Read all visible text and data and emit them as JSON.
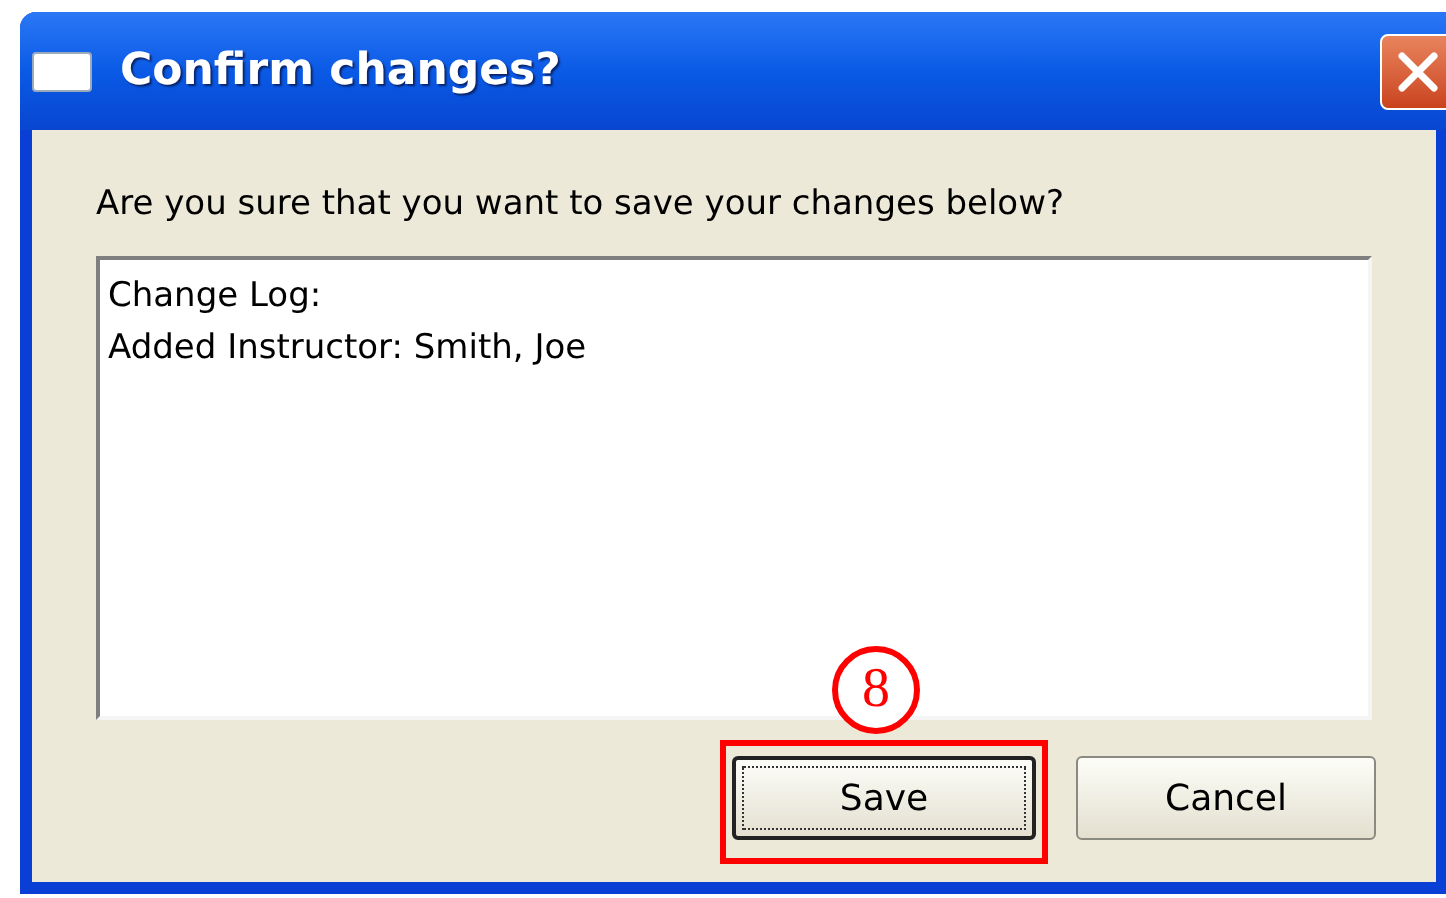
{
  "window": {
    "title": "Confirm changes?"
  },
  "prompt": "Are you sure that you want to save your changes below?",
  "change_log": {
    "lines": [
      "Change Log:",
      "Added Instructor: Smith, Joe"
    ]
  },
  "buttons": [
    {
      "label": "Save",
      "default": true,
      "highlighted": true
    },
    {
      "label": "Cancel",
      "default": false,
      "highlighted": false
    }
  ],
  "annotation": {
    "number": "8"
  }
}
